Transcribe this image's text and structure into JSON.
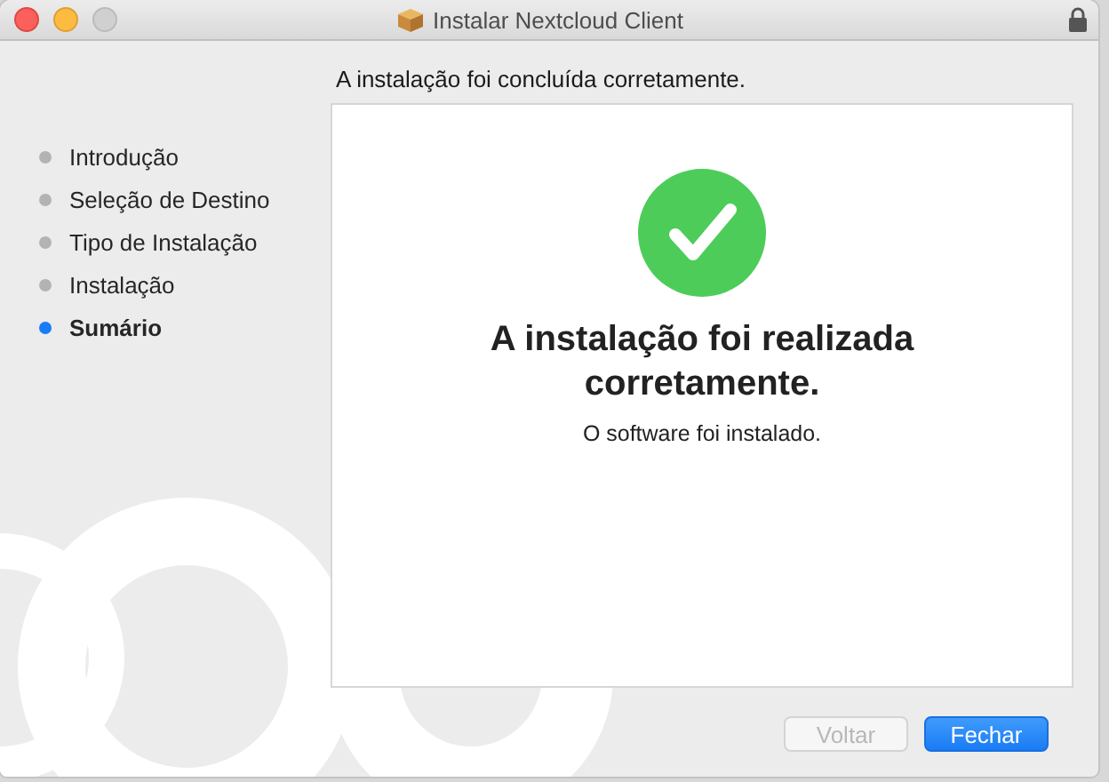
{
  "window": {
    "title": "Instalar Nextcloud Client"
  },
  "header": "A instalação foi concluída corretamente.",
  "steps": [
    {
      "label": "Introdução",
      "selected": false
    },
    {
      "label": "Seleção de Destino",
      "selected": false
    },
    {
      "label": "Tipo de Instalação",
      "selected": false
    },
    {
      "label": "Instalação",
      "selected": false
    },
    {
      "label": "Sumário",
      "selected": true
    }
  ],
  "result": {
    "title": "A instalação foi realizada corretamente.",
    "message": "O software foi instalado."
  },
  "buttons": [
    {
      "label": "Voltar",
      "kind": "secondary",
      "disabled": true
    },
    {
      "label": "Fechar",
      "kind": "primary",
      "disabled": false
    }
  ]
}
